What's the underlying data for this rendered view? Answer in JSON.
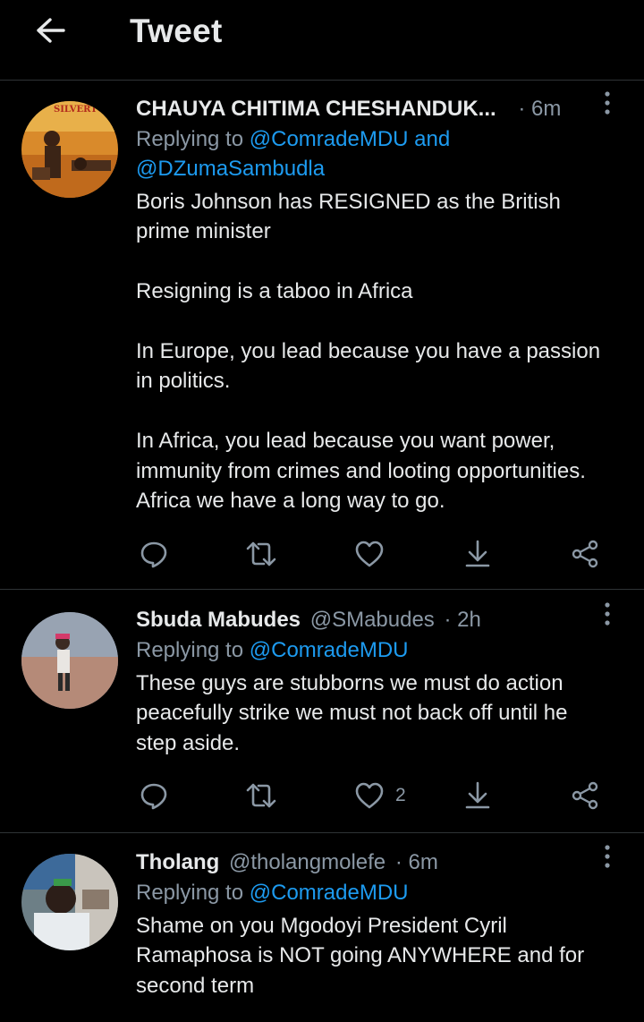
{
  "header": {
    "title": "Tweet"
  },
  "tweets": [
    {
      "name": "CHAUYA CHITIMA CHESHANDUK...",
      "handle": "",
      "time": "· 6m",
      "replying_prefix": "Replying to ",
      "mention1": "@ComradeMDU",
      "conj": " and",
      "mention2": "@DZumaSambudla",
      "avatar_text": "SILVERTON SIL",
      "body_lines": [
        "Boris Johnson has RESIGNED as the British",
        "prime minister",
        "Resigning is a taboo in Africa",
        "In Europe, you lead because you have a passion",
        "in politics.",
        "In Africa, you lead because you want power,",
        "immunity from crimes and looting opportunities.",
        "Africa we have a long way to go."
      ],
      "likes": ""
    },
    {
      "name": "Sbuda Mabudes",
      "handle": "@SMabudes",
      "time": "· 2h",
      "replying_prefix": "Replying to ",
      "mention1": "@ComradeMDU",
      "body_lines": [
        "These guys are stubborns we must do action",
        "peacefully strike we must not back off until he",
        "step aside."
      ],
      "likes": "2"
    },
    {
      "name": "Tholang",
      "handle": "@tholangmolefe",
      "time": "· 6m",
      "replying_prefix": "Replying to ",
      "mention1": "@ComradeMDU",
      "body_lines": [
        "Shame on you Mgodoyi President Cyril",
        "Ramaphosa is NOT going ANYWHERE and for",
        "second term"
      ]
    }
  ],
  "icons": {
    "back": "arrow-left-icon",
    "more": "more-vertical-icon",
    "reply": "reply-icon",
    "retweet": "retweet-icon",
    "like": "heart-icon",
    "download": "download-icon",
    "share": "share-icon"
  },
  "colors": {
    "background": "#000000",
    "text": "#e7e9ea",
    "muted": "#8b98a5",
    "accent": "#1d9bf0",
    "divider": "#2f3336"
  }
}
